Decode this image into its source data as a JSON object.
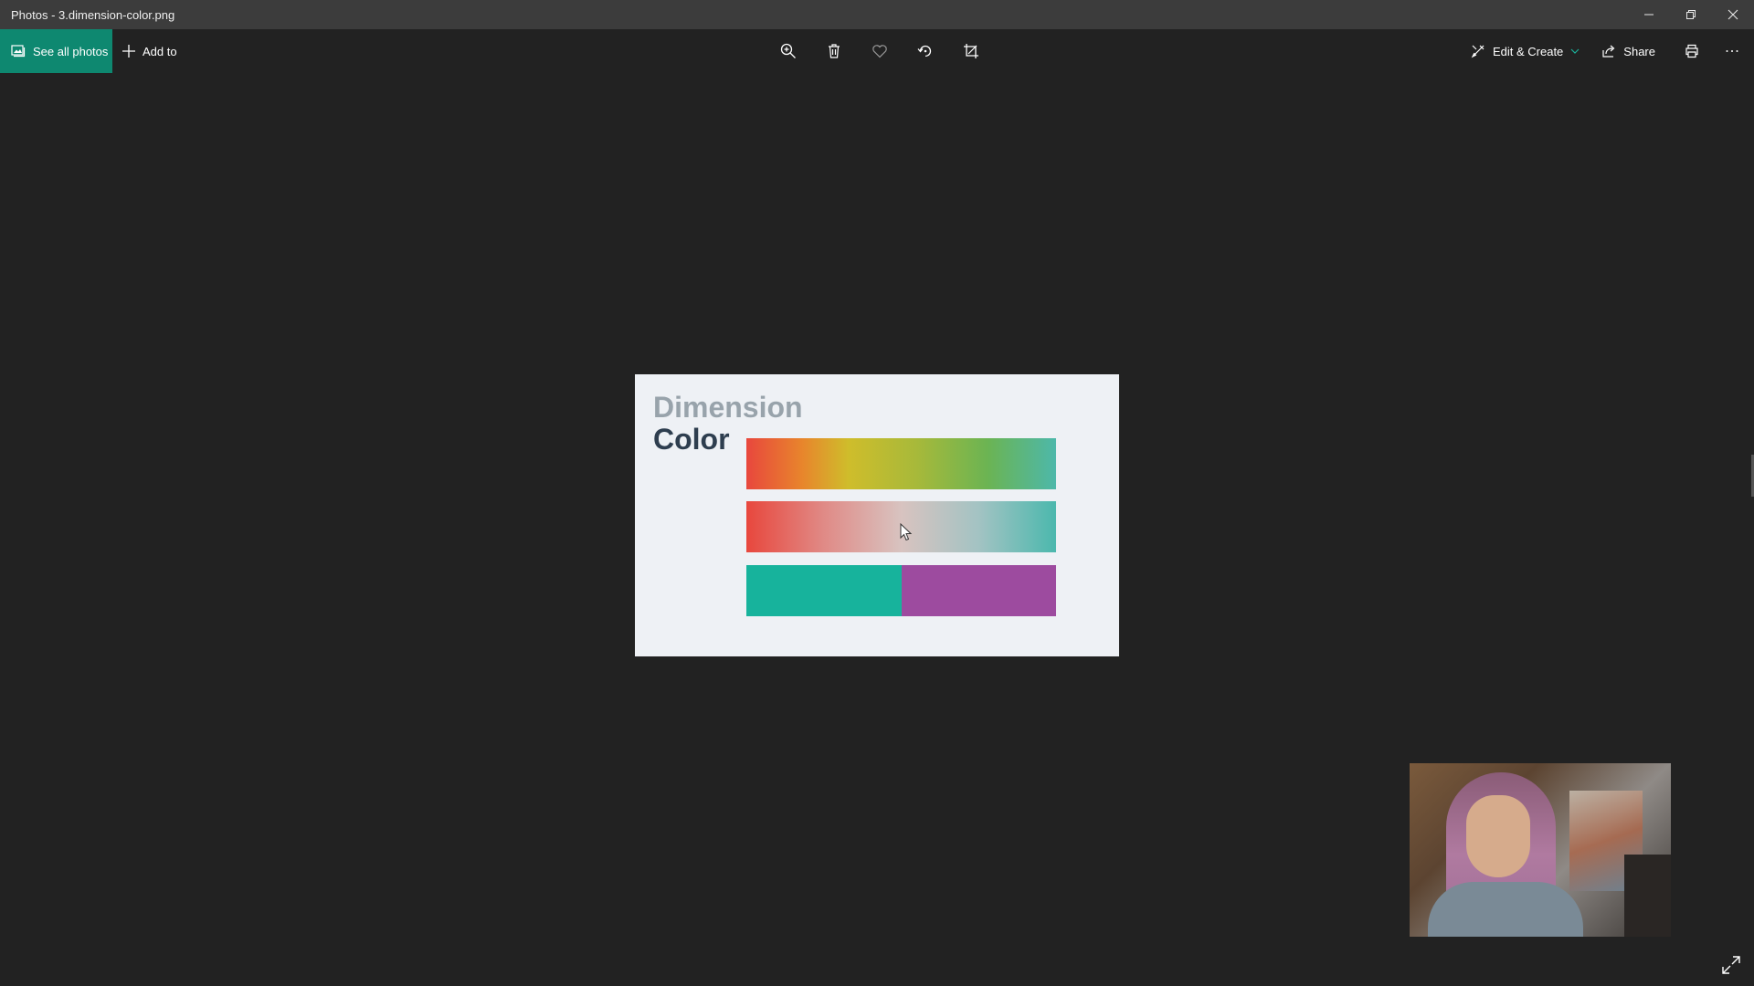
{
  "window": {
    "title": "Photos - 3.dimension-color.png"
  },
  "toolbar": {
    "see_all_label": "See all photos",
    "add_to_label": "Add to",
    "edit_create_label": "Edit & Create",
    "share_label": "Share"
  },
  "icons": {
    "gallery": "gallery-icon",
    "add": "plus-icon",
    "zoom": "zoom-in-icon",
    "delete": "trash-icon",
    "favorite": "heart-icon",
    "rotate": "rotate-icon",
    "crop": "crop-icon",
    "edit": "edit-icon",
    "share": "share-icon",
    "print": "print-icon",
    "more": "more-icon",
    "minimize": "minimize-icon",
    "restore": "restore-icon",
    "close": "close-icon",
    "expand": "expand-icon"
  },
  "photo": {
    "line1": "Dimension",
    "line2": "Color",
    "split_colors": [
      "#17b39c",
      "#9d4b9f"
    ]
  },
  "colors": {
    "accent": "#0e8870",
    "titlebar": "#3c3c3c",
    "background": "#222222"
  }
}
